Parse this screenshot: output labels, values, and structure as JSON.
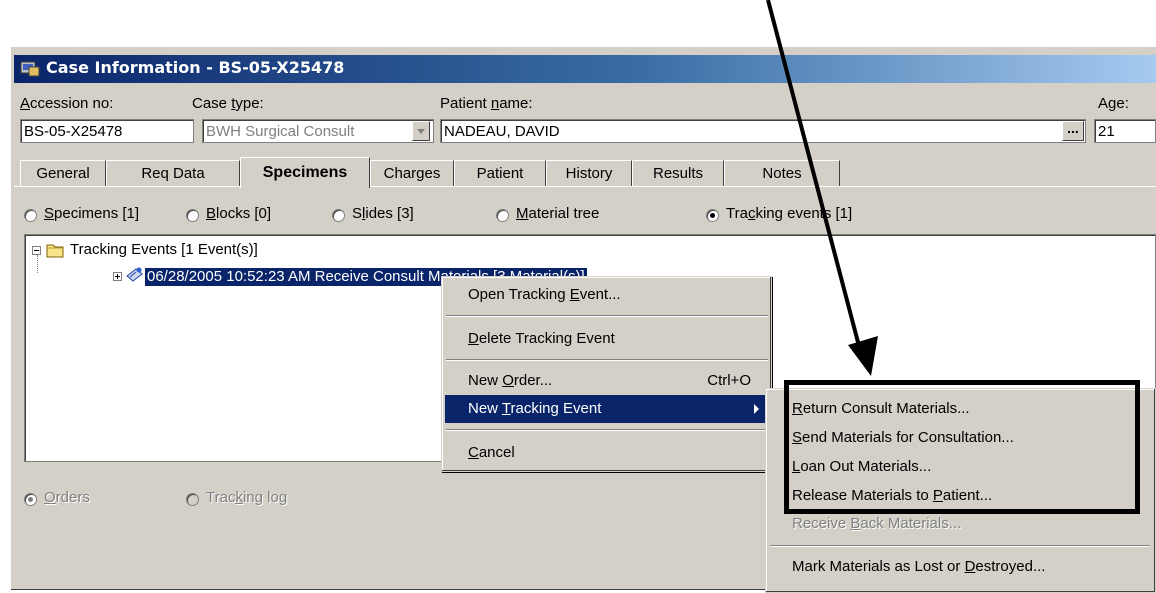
{
  "window": {
    "title": "Case Information - BS-05-X25478"
  },
  "header": {
    "accession_label_u": "A",
    "accession_label_rest": "ccession no:",
    "accession_value": "BS-05-X25478",
    "case_type_label_pre": "Case ",
    "case_type_label_u": "t",
    "case_type_label_rest": "ype:",
    "case_type_value": "BWH Surgical Consult",
    "patient_label_pre": "Patient ",
    "patient_label_u": "n",
    "patient_label_rest": "ame:",
    "patient_value": "NADEAU, DAVID",
    "lookup_button": "...",
    "age_label_pre": "A",
    "age_label_u": "g",
    "age_label_rest": "e:",
    "age_value": "21"
  },
  "tabs": [
    {
      "label": "General"
    },
    {
      "label": "Req Data"
    },
    {
      "label": "Specimens"
    },
    {
      "label": "Charges"
    },
    {
      "label": "Patient"
    },
    {
      "label": "History"
    },
    {
      "label": "Results"
    },
    {
      "label": "Notes"
    }
  ],
  "view_options": [
    {
      "u": "S",
      "rest": "pecimens [1]"
    },
    {
      "u": "B",
      "rest": "locks [0]"
    },
    {
      "pre": "S",
      "u": "l",
      "rest": "ides [3]"
    },
    {
      "u": "M",
      "rest": "aterial tree"
    },
    {
      "pre": "Tra",
      "u": "c",
      "rest": "king events [1]"
    }
  ],
  "tree": {
    "root": "Tracking Events [1 Event(s)]",
    "item": "06/28/2005 10:52:23 AM Receive Consult Materials [3 Material(s)]"
  },
  "bottom_options": [
    {
      "u": "O",
      "rest": "rders"
    },
    {
      "pre": "Trac",
      "u": "k",
      "rest": "ing log"
    }
  ],
  "context_menu": {
    "open_pre": "Open Tracking ",
    "open_u": "E",
    "open_rest": "vent...",
    "delete_u": "D",
    "delete_rest": "elete Tracking Event",
    "new_order_pre": "New ",
    "new_order_u": "O",
    "new_order_rest": "rder...",
    "new_order_shortcut": "Ctrl+O",
    "new_tracking_pre": "New ",
    "new_tracking_u": "T",
    "new_tracking_rest": "racking Event",
    "cancel_u": "C",
    "cancel_rest": "ancel"
  },
  "submenu": {
    "return_u": "R",
    "return_rest": "eturn Consult Materials...",
    "send_u": "S",
    "send_rest": "end Materials for Consultation...",
    "loan_u": "L",
    "loan_rest": "oan Out Materials...",
    "release_pre": "Release Materials to ",
    "release_u": "P",
    "release_rest": "atient...",
    "receive_pre": "Receive ",
    "receive_u": "B",
    "receive_rest": "ack Materials...",
    "mark_pre": "Mark Materials as Lost or ",
    "mark_u": "D",
    "mark_rest": "estroyed..."
  },
  "colors": {
    "selection": "#0a246a",
    "face": "#d4d0c8"
  }
}
